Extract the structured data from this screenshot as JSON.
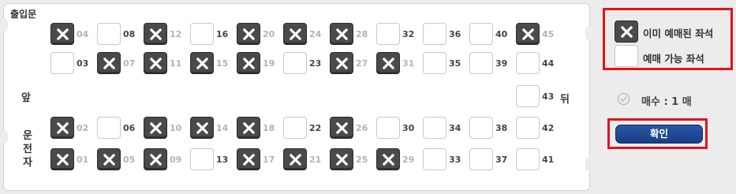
{
  "bus": {
    "entrance_label": "출입문",
    "front_label": "앞",
    "rear_label": "뒤",
    "driver_label": "운전자"
  },
  "seat_rows": [
    [
      {
        "num": "04",
        "taken": true
      },
      {
        "num": "08",
        "taken": false
      },
      {
        "num": "12",
        "taken": true
      },
      {
        "num": "16",
        "taken": false
      },
      {
        "num": "20",
        "taken": true
      },
      {
        "num": "24",
        "taken": true
      },
      {
        "num": "28",
        "taken": true
      },
      {
        "num": "32",
        "taken": false
      },
      {
        "num": "36",
        "taken": false
      },
      {
        "num": "40",
        "taken": false
      },
      {
        "num": "45",
        "taken": true
      }
    ],
    [
      {
        "num": "03",
        "taken": false
      },
      {
        "num": "07",
        "taken": true
      },
      {
        "num": "11",
        "taken": true
      },
      {
        "num": "15",
        "taken": true
      },
      {
        "num": "19",
        "taken": true
      },
      {
        "num": "23",
        "taken": false
      },
      {
        "num": "27",
        "taken": true
      },
      {
        "num": "31",
        "taken": true
      },
      {
        "num": "35",
        "taken": false
      },
      {
        "num": "39",
        "taken": false
      },
      {
        "num": "44",
        "taken": false
      }
    ],
    [
      {
        "num": "43",
        "taken": false
      }
    ],
    [
      {
        "num": "02",
        "taken": true
      },
      {
        "num": "06",
        "taken": false
      },
      {
        "num": "10",
        "taken": true
      },
      {
        "num": "14",
        "taken": true
      },
      {
        "num": "18",
        "taken": true
      },
      {
        "num": "22",
        "taken": false
      },
      {
        "num": "26",
        "taken": true
      },
      {
        "num": "30",
        "taken": false
      },
      {
        "num": "34",
        "taken": false
      },
      {
        "num": "38",
        "taken": false
      },
      {
        "num": "42",
        "taken": false
      }
    ],
    [
      {
        "num": "01",
        "taken": true
      },
      {
        "num": "05",
        "taken": true
      },
      {
        "num": "09",
        "taken": true
      },
      {
        "num": "13",
        "taken": false
      },
      {
        "num": "17",
        "taken": true
      },
      {
        "num": "21",
        "taken": true
      },
      {
        "num": "25",
        "taken": true
      },
      {
        "num": "29",
        "taken": true
      },
      {
        "num": "33",
        "taken": false
      },
      {
        "num": "37",
        "taken": false
      },
      {
        "num": "41",
        "taken": false
      }
    ]
  ],
  "legend": {
    "taken_label": "이미 예매된 좌석",
    "available_label": "예매 가능 좌석"
  },
  "selection": {
    "count_label": "매수 : 1 매"
  },
  "confirm_button": {
    "label": "확인"
  },
  "colors": {
    "taken_seat": "#4a4a4a",
    "highlight": "#e0141e",
    "button": "#1f4b98"
  },
  "icons": {
    "taken_mark": "x-mark-icon",
    "count": "check-circle-icon"
  }
}
